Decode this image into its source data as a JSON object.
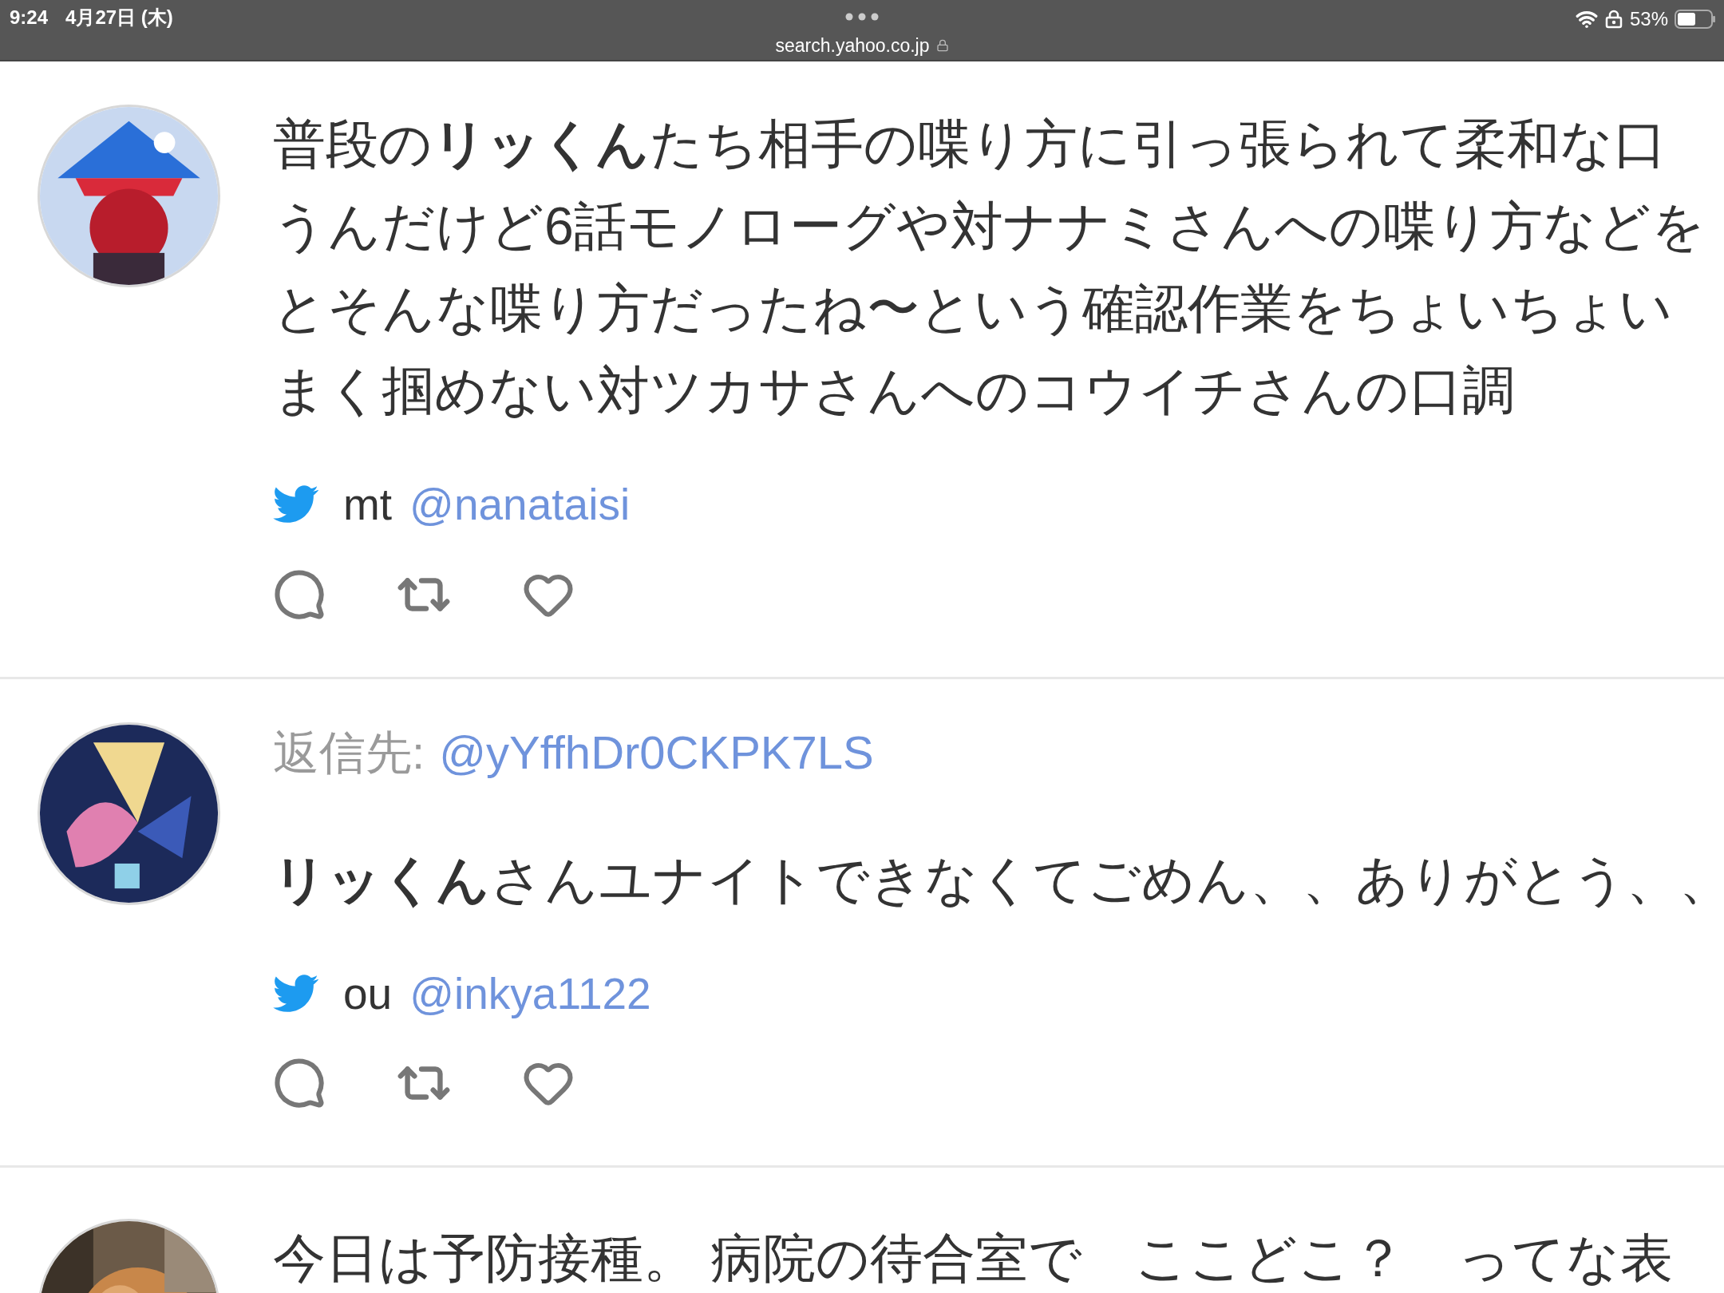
{
  "status_bar": {
    "time": "9:24",
    "date": "4月27日 (木)",
    "battery": "53%"
  },
  "address_bar": {
    "url": "search.yahoo.co.jp"
  },
  "tweets": [
    {
      "lines": [
        "普段の**リッくん**たち相手の喋り方に引っ張られて柔和な口",
        "うんだけど6話モノローグや対ナナミさんへの喋り方などを",
        "とそんな喋り方だったね〜という確認作業をちょいちょい",
        "まく掴めない対ツカサさんへのコウイチさんの口調"
      ],
      "author": {
        "name": "mt",
        "handle": "@nanataisi"
      }
    },
    {
      "reply_to": {
        "label": "返信先:",
        "handle": "@yYffhDr0CKPK7LS"
      },
      "lines": [
        "**リッくん**さんユナイトできなくてごめん、、ありがとう、、"
      ],
      "author": {
        "name": "ou",
        "handle": "@inkya1122"
      }
    },
    {
      "lines": [
        "今日は予防接種。 病院の待合室で　ここどこ？　ってな表"
      ]
    }
  ]
}
